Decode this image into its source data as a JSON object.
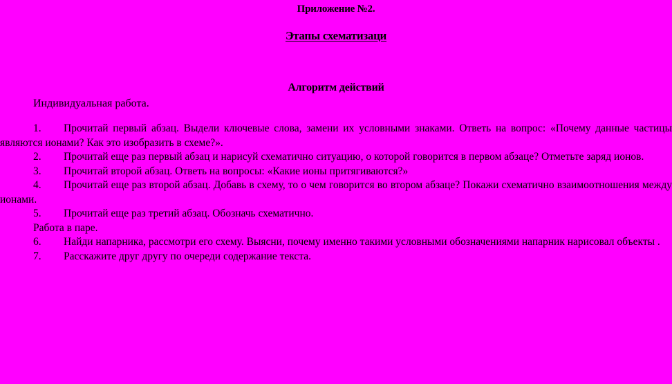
{
  "document": {
    "background_color": "#ff00ff",
    "text_color": "#000000",
    "heading_appendix": "Приложение №2.",
    "heading_underlined": "Этапы схематизаци",
    "heading_algorithm": "Алгоритм действий",
    "section_individual": "Индивидуальная работа.",
    "section_pair": "Работа в паре.",
    "items": [
      {
        "number": "1.",
        "text": "Прочитай первый абзац. Выдели ключевые слова, замени их условными знаками. Ответь на вопрос: «Почему данные частицы являются ионами? Как  это изобразить в схеме?»."
      },
      {
        "number": "2.",
        "text": "Прочитай еще раз первый абзац и нарисуй схематично ситуацию, о которой говорится в первом абзаце? Отметьте заряд ионов."
      },
      {
        "number": "3.",
        "text": "Прочитай второй абзац. Ответь на вопросы: «Какие ионы притягиваются?»"
      },
      {
        "number": "4.",
        "text": "Прочитай еще раз второй абзац. Добавь в схему, то о чем говорится во втором абзаце? Покажи схематично взаимоотношения между ионами."
      },
      {
        "number": "5.",
        "text": "Прочитай еще раз третий абзац. Обозначь схематично."
      },
      {
        "number": "6.",
        "text": "Найди напарника, рассмотри его схему. Выясни, почему именно такими условными обозначениями напарник нарисовал объекты ."
      },
      {
        "number": "7.",
        "text": "Расскажите друг другу по очереди содержание текста."
      }
    ]
  }
}
